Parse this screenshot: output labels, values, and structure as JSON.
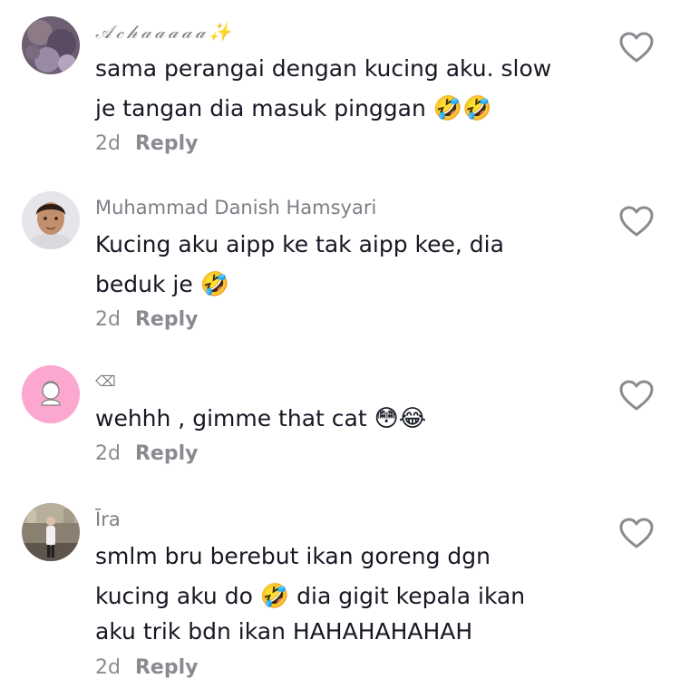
{
  "comments": [
    {
      "username": "𝒜𝒸𝒽𝒶𝒶𝒶𝒶𝒶",
      "username_suffix": "✨",
      "text_line1": "sama perangai dengan kucing aku. slow",
      "text_line2": "je tangan dia masuk pinggan",
      "text_line2_emoji": "🤣🤣",
      "time": "2d",
      "reply_label": "Reply"
    },
    {
      "username": "Muhammad Danish Hamsyari",
      "text_line1": "Kucing aku aipp ke tak aipp kee, dia",
      "text_line2": "beduk je",
      "text_line2_emoji": "🤣",
      "time": "2d",
      "reply_label": "Reply"
    },
    {
      "username": "⌫",
      "text_line1": "wehhh , gimme that cat",
      "text_line1_emoji": "😳😂",
      "time": "2d",
      "reply_label": "Reply"
    },
    {
      "username": "Īra",
      "text_line1": "smlm bru berebut ikan goreng dgn",
      "text_line2_a": "kucing aku do",
      "text_line2_emoji": "🤣",
      "text_line2_b": "dia gigit kepala ikan",
      "text_line3": "aku trik bdn ikan HAHAHAHAHAH",
      "time": "2d",
      "reply_label": "Reply"
    }
  ],
  "colors": {
    "text": "#161823",
    "muted": "#8a8b91",
    "background": "#ffffff",
    "avatar3_bg": "#fba7cf"
  },
  "icons": {
    "like": "heart-outline-icon"
  }
}
